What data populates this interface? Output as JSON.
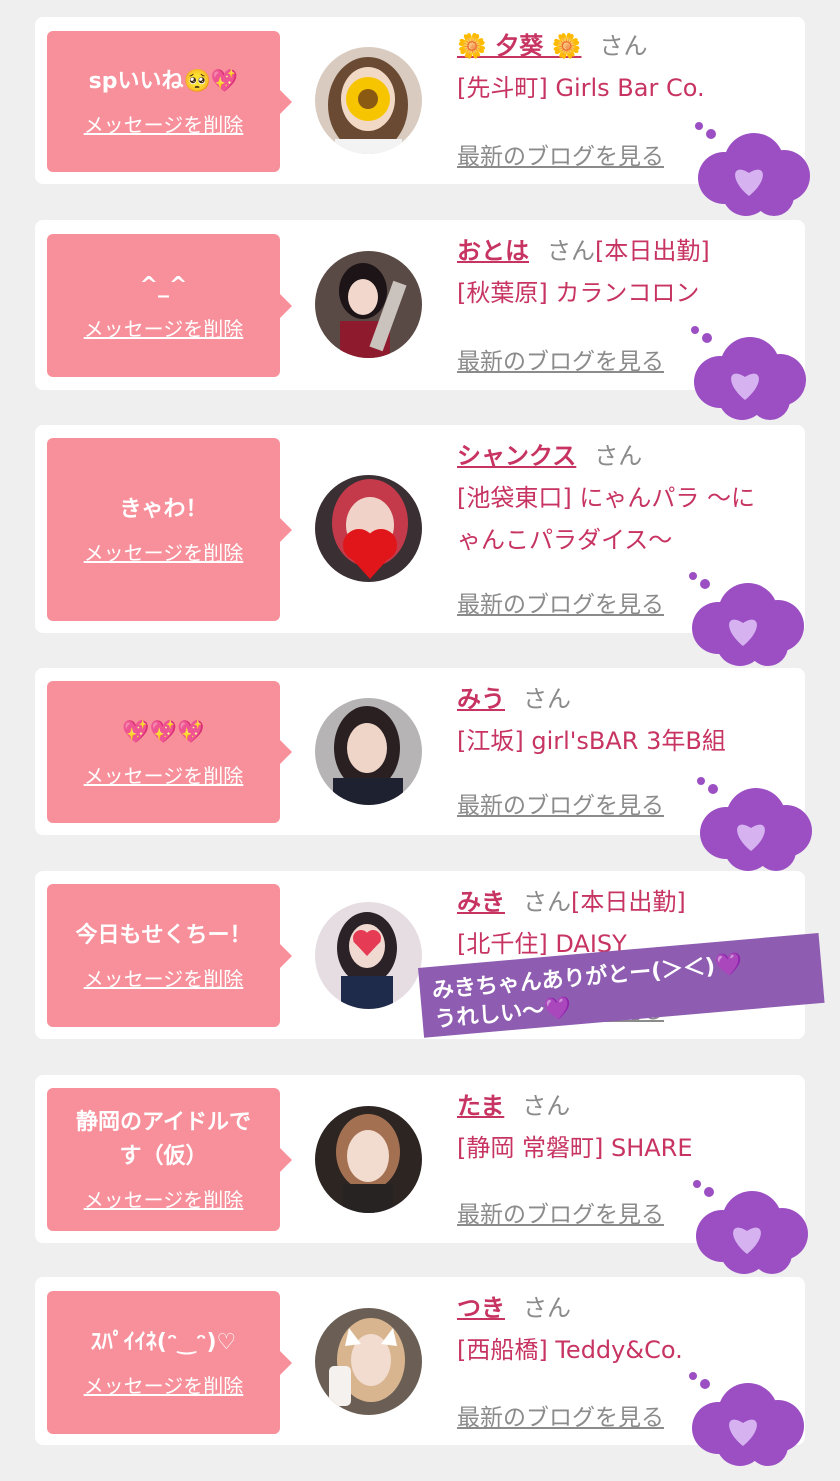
{
  "common": {
    "delete_label": "メッセージを削除",
    "blog_label": "最新のブログを見る",
    "san_label": "さん"
  },
  "cards": [
    {
      "message": "spいいね🥺💖",
      "name": "🌼 夕葵 🌼",
      "attend": "",
      "shop": "[先斗町] Girls Bar Co."
    },
    {
      "message": "^_^",
      "name": "おとは",
      "attend": "[本日出勤]",
      "shop": "[秋葉原] カランコロン"
    },
    {
      "message": "きゃわ！",
      "name": "シャンクス",
      "attend": "",
      "shop": "[池袋東口] にゃんパラ 〜にゃんこパラダイス〜"
    },
    {
      "message": "💖💖💖",
      "name": "みう",
      "attend": "",
      "shop": "[江坂] girl'sBAR 3年B組"
    },
    {
      "message": "今日もせくちー！",
      "name": "みき",
      "attend": "[本日出勤]",
      "shop": "[北千住] DAISY"
    },
    {
      "message": "静岡のアイドルです（仮）",
      "name": "たま",
      "attend": "",
      "shop": "[静岡 常磐町] SHARE"
    },
    {
      "message": "ｽﾊﾟｲｲﾈ(ᵔ‿ᵔ)♡",
      "name": "つき",
      "attend": "",
      "shop": "[西船橋] Teddy&Co."
    }
  ],
  "sticker": {
    "text": "みきちゃんありがとー(＞＜)💜\nうれしい〜💜"
  },
  "colors": {
    "background": "#efeff0",
    "bubble": "#f7909a",
    "accent": "#c73462",
    "cloud": "#9b4fc3",
    "sticker": "#8e5cb0"
  }
}
